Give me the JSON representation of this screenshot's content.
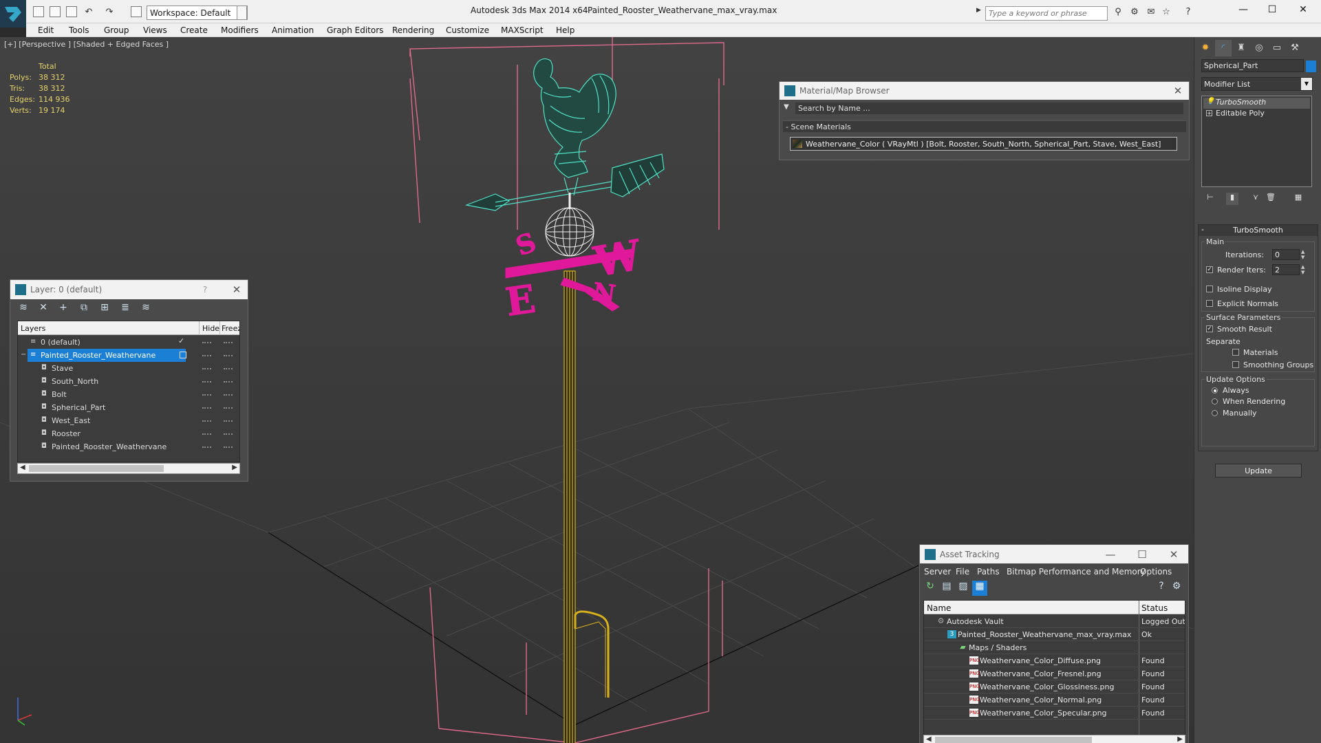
{
  "titlebar": {
    "workspace": "Workspace: Default",
    "app_title": "Autodesk 3ds Max  2014 x64",
    "file_title": "Painted_Rooster_Weathervane_max_vray.max",
    "search_placeholder": "Type a keyword or phrase"
  },
  "menubar": [
    "Edit",
    "Tools",
    "Group",
    "Views",
    "Create",
    "Modifiers",
    "Animation",
    "Graph Editors",
    "Rendering",
    "Customize",
    "MAXScript",
    "Help"
  ],
  "viewport": {
    "label": "[+] [Perspective ] [Shaded + Edged Faces ]",
    "stats_header": "Total",
    "stats": [
      {
        "key": "Polys:",
        "value": "38 312"
      },
      {
        "key": "Tris:",
        "value": "38 312"
      },
      {
        "key": "Edges:",
        "value": "114 936"
      },
      {
        "key": "Verts:",
        "value": "19 174"
      }
    ],
    "letters": {
      "s": "S",
      "w": "W",
      "e": "E",
      "n": "N"
    },
    "colors": {
      "rooster": "#4fe3c8",
      "compass": "#e0189a",
      "pole": "#d8b21a",
      "bbox": "#e06a8a"
    }
  },
  "layer_window": {
    "title": "Layer: 0 (default)",
    "col_layers": "Layers",
    "col_hide": "Hide",
    "col_freeze": "Freez",
    "rows": [
      {
        "name": "0 (default)"
      },
      {
        "name": "Painted_Rooster_Weathervane"
      },
      {
        "name": "Stave"
      },
      {
        "name": "South_North"
      },
      {
        "name": "Bolt"
      },
      {
        "name": "Spherical_Part"
      },
      {
        "name": "West_East"
      },
      {
        "name": "Rooster"
      },
      {
        "name": "Painted_Rooster_Weathervane"
      }
    ]
  },
  "material_browser": {
    "title": "Material/Map Browser",
    "search_placeholder": "Search by Name ...",
    "section": "- Scene Materials",
    "entry": "Weathervane_Color  ( VRayMtl ) [Bolt, Rooster, South_North, Spherical_Part, Stave, West_East]"
  },
  "command_panel": {
    "object_name": "Spherical_Part",
    "modifier_list": "Modifier List",
    "stack": [
      "TurboSmooth",
      "Editable Poly"
    ],
    "rollout_title": "TurboSmooth",
    "main_group": "Main",
    "iterations_label": "Iterations:",
    "iterations_value": "0",
    "render_iters_label": "Render Iters:",
    "render_iters_value": "2",
    "isoline_display": "Isoline Display",
    "explicit_normals": "Explicit Normals",
    "surface_group": "Surface Parameters",
    "smooth_result": "Smooth Result",
    "separate_label": "Separate",
    "materials": "Materials",
    "smoothing_groups": "Smoothing Groups",
    "update_group": "Update Options",
    "always": "Always",
    "when_rendering": "When Rendering",
    "manually": "Manually",
    "update_button": "Update"
  },
  "asset_tracking": {
    "title": "Asset Tracking",
    "menu": [
      "Server",
      "File",
      "Paths",
      "Bitmap Performance and Memory",
      "Options"
    ],
    "col_name": "Name",
    "col_status": "Status",
    "rows": [
      {
        "name": "Autodesk Vault",
        "status": "Logged Out"
      },
      {
        "name": "Painted_Rooster_Weathervane_max_vray.max",
        "status": "Ok"
      },
      {
        "name": "Maps / Shaders",
        "status": ""
      },
      {
        "name": "Weathervane_Color_Diffuse.png",
        "status": "Found"
      },
      {
        "name": "Weathervane_Color_Fresnel.png",
        "status": "Found"
      },
      {
        "name": "Weathervane_Color_Glossiness.png",
        "status": "Found"
      },
      {
        "name": "Weathervane_Color_Normal.png",
        "status": "Found"
      },
      {
        "name": "Weathervane_Color_Specular.png",
        "status": "Found"
      }
    ],
    "png_icon_label": "PNG"
  }
}
